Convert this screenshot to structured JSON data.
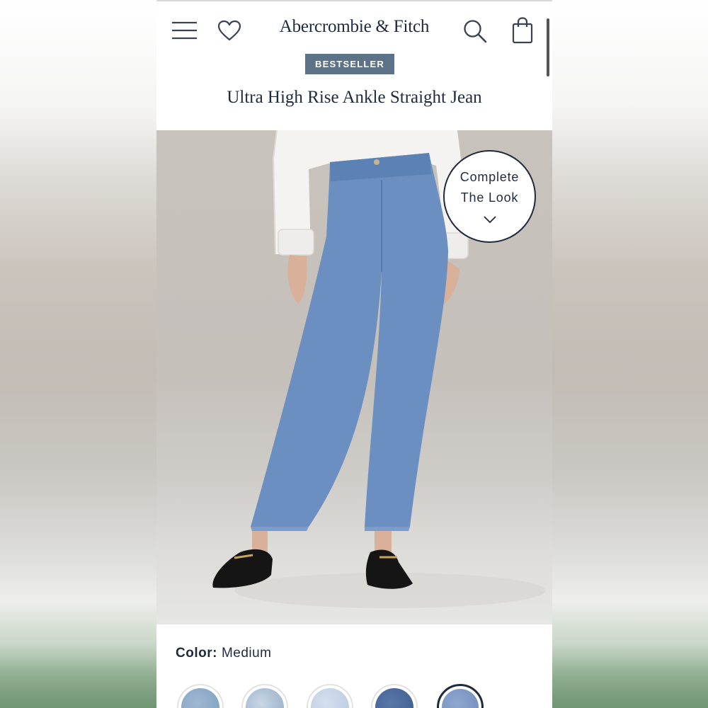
{
  "app": {
    "brand": "Abercrombie & Fitch",
    "accent_color": "#1f2a3d",
    "badge_color": "#5b7287"
  },
  "header": {
    "icons": [
      "menu-icon",
      "heart-icon",
      "search-icon",
      "shopping-bag-icon"
    ]
  },
  "product": {
    "badge": "BESTSELLER",
    "title": "Ultra High Rise Ankle Straight Jean"
  },
  "complete_the_look": {
    "line1": "Complete",
    "line2": "The Look",
    "icon": "chevron-down-icon"
  },
  "color_selector": {
    "label": "Color:",
    "selected_value": "Medium",
    "swatches": [
      {
        "shade": "#7f9ec0"
      },
      {
        "shade": "#93a9c3"
      },
      {
        "shade": "#b9c8de"
      },
      {
        "shade": "#3c5a8e"
      },
      {
        "shade": "#6f8bbb",
        "selected": true
      }
    ]
  }
}
